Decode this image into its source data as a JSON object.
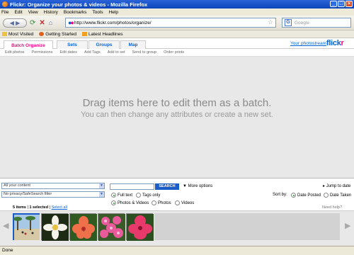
{
  "window": {
    "title": "Flickr: Organize your photos & videos - Mozilla Firefox"
  },
  "menu": [
    "File",
    "Edit",
    "View",
    "History",
    "Bookmarks",
    "Tools",
    "Help"
  ],
  "nav": {
    "url": "http://www.flickr.com/photos/organize/",
    "search_placeholder": "Google"
  },
  "bookmarks": [
    "Most Visited",
    "Getting Started",
    "Latest Headlines"
  ],
  "flickr": {
    "tabs": [
      "Batch Organize",
      "Sets",
      "Groups",
      "Map"
    ],
    "photostream_link": "Your photostream",
    "logo_a": "flickr",
    "logo_b": "r"
  },
  "toolbar": [
    "Edit photos",
    "Permissions",
    "Edit dates",
    "Add Tags",
    "Add to set",
    "Send to group",
    "Order prints"
  ],
  "dropzone": {
    "line1": "Drag items here to edit them as a batch.",
    "line2": "You can then change any attributes or create a new set."
  },
  "filters": {
    "content_select": "All your content",
    "privacy_select": "No privacy/SafeSearch filter",
    "search_button": "SEARCH",
    "more_options": "More options",
    "jump_to_date": "Jump to date",
    "radio_fulltext": "Full text",
    "radio_tags": "Tags only",
    "radio_photos_videos": "Photos & Videos",
    "radio_photos": "Photos",
    "radio_videos": "Videos",
    "sort_by": "Sort by:",
    "radio_date_posted": "Date Posted",
    "radio_date_taken": "Date Taken"
  },
  "tray": {
    "count": "5 items",
    "selected": "1 selected",
    "select_all": "Select all",
    "help": "Need help?"
  },
  "status": "Done",
  "colors": {
    "flickr_blue": "#0063dc",
    "flickr_pink": "#ff0084"
  }
}
